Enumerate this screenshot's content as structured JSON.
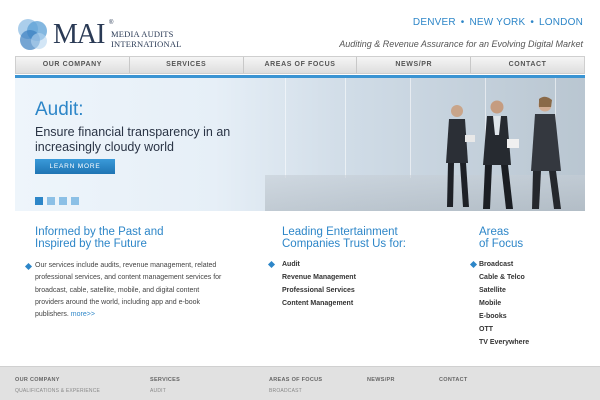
{
  "header": {
    "logo_mark": "MAI",
    "logo_reg": "®",
    "logo_line1": "Media Audits",
    "logo_line2": "International",
    "cities": [
      "DENVER",
      "NEW YORK",
      "LONDON"
    ],
    "city_separator": "•",
    "tagline": "Auditing & Revenue Assurance for an Evolving Digital Market"
  },
  "nav": {
    "items": [
      "OUR COMPANY",
      "SERVICES",
      "AREAS OF FOCUS",
      "NEWS/PR",
      "CONTACT"
    ]
  },
  "hero": {
    "title": "Audit:",
    "subtitle": "Ensure financial transparency in an increasingly cloudy world",
    "button": "LEARN MORE",
    "slide_count": 4,
    "active_slide": 1,
    "accent": "#2d86c8"
  },
  "intro": {
    "heading_line1": "Informed by the Past and",
    "heading_line2": "Inspired by the Future",
    "body": "Our services include audits, revenue management, related professional services, and content management services for broadcast, cable, satellite, mobile, and digital content providers around the world, including app and e-book publishers.",
    "more": "more>>"
  },
  "trust": {
    "heading_line1": "Leading Entertainment",
    "heading_line2": "Companies Trust Us for:",
    "items": [
      "Audit",
      "Revenue Management",
      "Professional Services",
      "Content Management"
    ]
  },
  "focus": {
    "heading_line1": "Areas",
    "heading_line2": "of Focus",
    "items": [
      "Broadcast",
      "Cable & Telco",
      "Satellite",
      "Mobile",
      "E-books",
      "OTT",
      "TV Everywhere"
    ]
  },
  "footer": {
    "columns": [
      {
        "heading": "OUR COMPANY",
        "item": "QUALIFICATIONS & EXPERIENCE"
      },
      {
        "heading": "SERVICES",
        "item": "AUDIT"
      },
      {
        "heading": "AREAS OF FOCUS",
        "item": "BROADCAST"
      },
      {
        "heading": "NEWS/PR",
        "item": ""
      },
      {
        "heading": "CONTACT",
        "item": ""
      }
    ]
  }
}
